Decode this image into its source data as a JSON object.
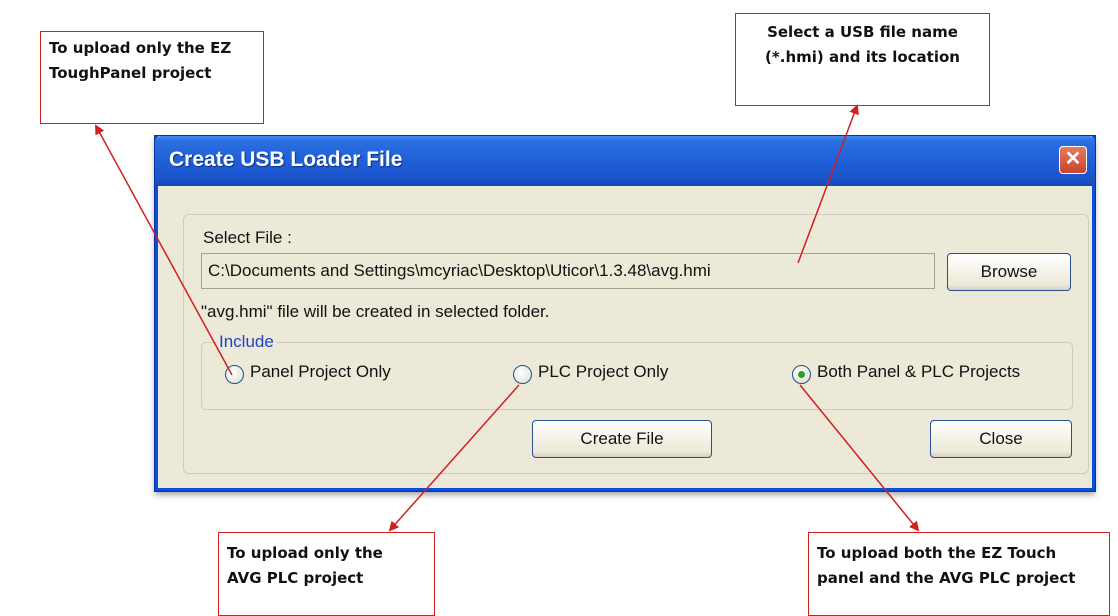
{
  "callouts": {
    "panel_only": [
      "To upload only the  EZ",
      "ToughPanel project"
    ],
    "usb_file": [
      "Select a USB file name",
      "(*.hmi) and its location"
    ],
    "plc_only": [
      "To upload only the",
      "AVG PLC project"
    ],
    "both": [
      "To upload both the  EZ Touch",
      "panel and the AVG PLC project"
    ]
  },
  "dialog": {
    "title": "Create USB Loader File",
    "close_glyph": "✕",
    "select_file_label": "Select File :",
    "file_path_value": "C:\\Documents and Settings\\mcyriac\\Desktop\\Uticor\\1.3.48\\avg.hmi",
    "browse_label": "Browse",
    "info_text": "\"avg.hmi\" file will be created in selected folder.",
    "include_label": "Include",
    "options": [
      {
        "label": "Panel Project Only",
        "selected": false
      },
      {
        "label": "PLC Project Only",
        "selected": false
      },
      {
        "label": "Both Panel & PLC Projects",
        "selected": true
      }
    ],
    "create_label": "Create File",
    "close_label": "Close"
  },
  "colors": {
    "callout_border": "#d21f1f",
    "arrow": "#d21f1f",
    "titlebar": "#1f5fd8",
    "dialog_bg": "#ece9d8",
    "include_legend": "#1b45c4",
    "radio_selected": "#26a32a"
  }
}
